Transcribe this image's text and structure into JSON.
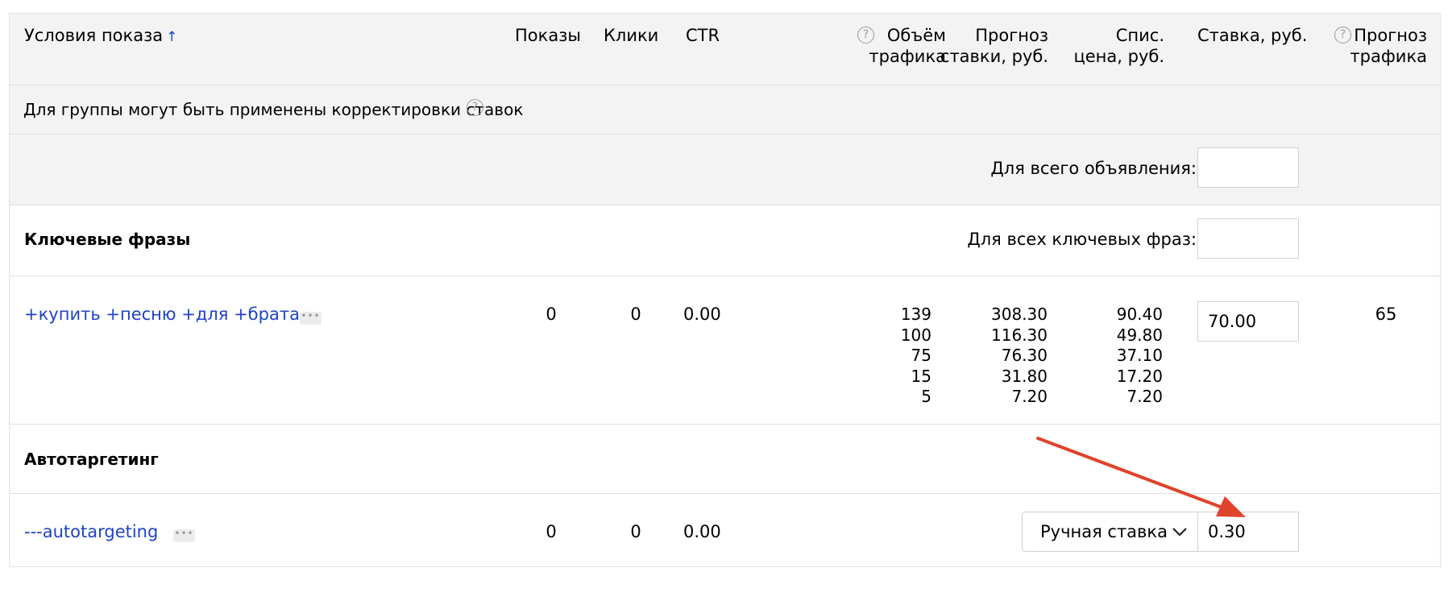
{
  "header": {
    "conditions": "Условия показа",
    "sort_arrow": "↑",
    "shows": "Показы",
    "clicks": "Клики",
    "ctr": "CTR",
    "traffic_volume_l1": "Объём",
    "traffic_volume_l2": "трафика",
    "forecast_bid_l1": "Прогноз",
    "forecast_bid_l2": "ставки, руб.",
    "charged_price_l1": "Спис.",
    "charged_price_l2": "цена, руб.",
    "bid": "Ставка, руб.",
    "traffic_forecast_l1": "Прогноз",
    "traffic_forecast_l2": "трафика",
    "help_glyph": "?"
  },
  "note": {
    "text": "Для группы могут быть применены корректировки ставок",
    "help_glyph": "?"
  },
  "whole_ad": {
    "label": "Для всего объявления:",
    "value": ""
  },
  "keywords_section": {
    "title": "Ключевые фразы",
    "all_label": "Для всех ключевых фраз:",
    "all_value": ""
  },
  "keyword_row": {
    "phrase": "+купить +песню +для +брата",
    "more": "•••",
    "shows": "0",
    "clicks": "0",
    "ctr": "0.00",
    "traffic_volume": [
      "139",
      "100",
      "75",
      "15",
      "5"
    ],
    "forecast_bid": [
      "308.30",
      "116.30",
      "76.30",
      "31.80",
      "7.20"
    ],
    "charged_price": [
      "90.40",
      "49.80",
      "37.10",
      "17.20",
      "7.20"
    ],
    "bid_value": "70.00",
    "traffic_forecast": "65"
  },
  "autotargeting_section": {
    "title": "Автотаргетинг"
  },
  "autotargeting_row": {
    "phrase": "---autotargeting",
    "more": "•••",
    "shows": "0",
    "clicks": "0",
    "ctr": "0.00",
    "bid_mode": "Ручная ставка",
    "bid_value": "0.30"
  },
  "colors": {
    "link": "#1f43c6",
    "header_bg": "#f3f3f3",
    "border": "#e0e0e0",
    "annotation_arrow": "#e0432b"
  },
  "icons": [
    "help-icon",
    "sort-up-icon",
    "more-dots-icon",
    "chevron-down-icon",
    "annotation-arrow-icon"
  ]
}
